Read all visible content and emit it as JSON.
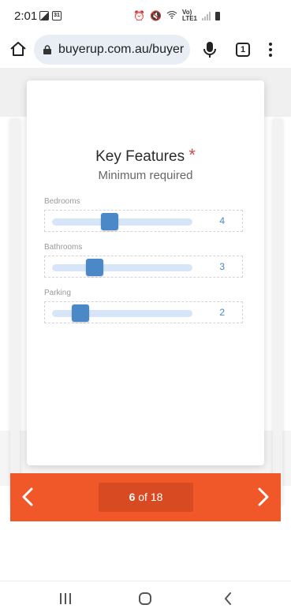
{
  "status_bar": {
    "time": "2:01",
    "calendar_day": "31",
    "network_top": "Vo)",
    "network_bottom": "LTE1"
  },
  "browser": {
    "url": "buyerup.com.au/buyer",
    "tab_count": "1"
  },
  "card": {
    "title": "Key Features",
    "required_mark": "*",
    "subtitle": "Minimum required",
    "sliders": [
      {
        "label": "Bedrooms",
        "value": "4",
        "fraction": 0.4
      },
      {
        "label": "Bathrooms",
        "value": "3",
        "fraction": 0.3
      },
      {
        "label": "Parking",
        "value": "2",
        "fraction": 0.2
      }
    ]
  },
  "navigation": {
    "current": "6",
    "separator": "of",
    "total": "18"
  },
  "colors": {
    "accent": "#4a88c8",
    "nav_bar": "#f0582a",
    "counter_bg": "#d84b22",
    "required": "#c94d4d"
  },
  "icons": {
    "home": "home-icon",
    "lock": "lock-icon",
    "mic": "microphone-icon",
    "menu": "more-vertical-icon",
    "prev": "chevron-left-icon",
    "next": "chevron-right-icon"
  }
}
